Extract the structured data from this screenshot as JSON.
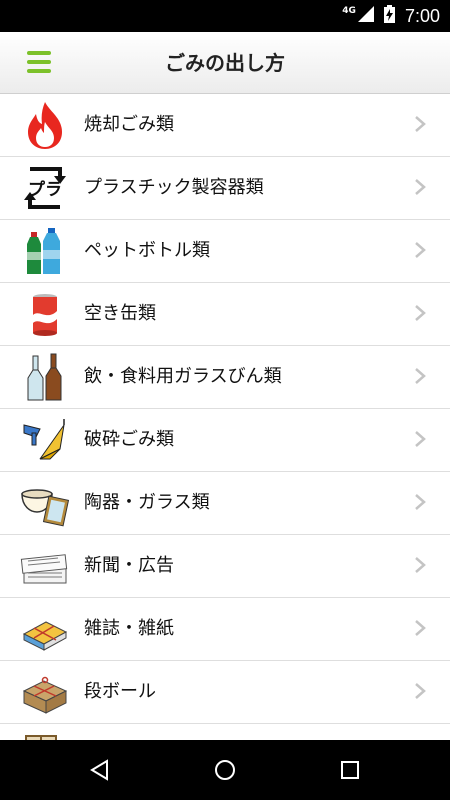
{
  "status_bar": {
    "network": "4G",
    "time": "7:00"
  },
  "header": {
    "title": "ごみの出し方",
    "menu_icon": "hamburger-menu-icon"
  },
  "colors": {
    "accent": "#7cc12a",
    "divider": "#dedede",
    "chevron": "#c4c4c4"
  },
  "items": [
    {
      "label": "焼却ごみ類",
      "icon": "flame-icon"
    },
    {
      "label": "プラスチック製容器類",
      "icon": "plastic-recycle-icon"
    },
    {
      "label": "ペットボトル類",
      "icon": "pet-bottle-icon"
    },
    {
      "label": "空き缶類",
      "icon": "can-icon"
    },
    {
      "label": "飲・食料用ガラスびん類",
      "icon": "glass-bottle-icon"
    },
    {
      "label": "破砕ごみ類",
      "icon": "hairdryer-umbrella-icon"
    },
    {
      "label": "陶器・ガラス類",
      "icon": "bowl-mirror-icon"
    },
    {
      "label": "新聞・広告",
      "icon": "newspaper-icon"
    },
    {
      "label": "雑誌・雑紙",
      "icon": "magazine-bundle-icon"
    },
    {
      "label": "段ボール",
      "icon": "cardboard-bundle-icon"
    },
    {
      "label": "",
      "icon": "furniture-icon"
    }
  ],
  "nav": {
    "back": "back-icon",
    "home": "home-icon",
    "recents": "recents-icon"
  }
}
